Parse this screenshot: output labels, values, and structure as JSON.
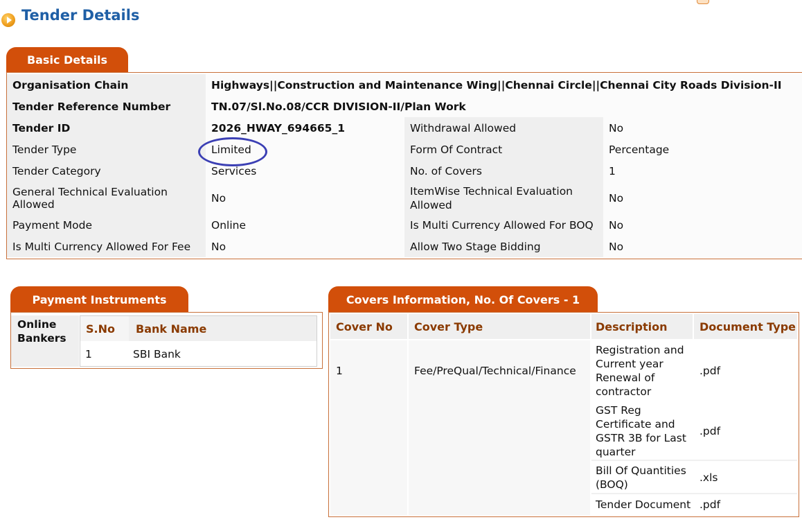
{
  "page": {
    "title": "Tender Details"
  },
  "basic_details": {
    "tab_label": "Basic Details",
    "org_chain_label": "Organisation Chain",
    "org_chain_value": "Highways||Construction and Maintenance Wing||Chennai Circle||Chennai City Roads Division-II",
    "ref_label": "Tender Reference Number",
    "ref_value": "TN.07/Sl.No.08/CCR DIVISION-II/Plan Work",
    "id_label": "Tender ID",
    "id_value": "2026_HWAY_694665_1",
    "withdrawal_label": "Withdrawal Allowed",
    "withdrawal_value": "No",
    "type_label": "Tender Type",
    "type_value": "Limited",
    "contract_label": "Form Of Contract",
    "contract_value": "Percentage",
    "category_label": "Tender Category",
    "category_value": "Services",
    "covers_label": "No. of Covers",
    "covers_value": "1",
    "gte_label": "General Technical Evaluation Allowed",
    "gte_value": "No",
    "itemwise_label": "ItemWise Technical Evaluation Allowed",
    "itemwise_value": "No",
    "payment_label": "Payment Mode",
    "payment_value": "Online",
    "boq_currency_label": "Is Multi Currency Allowed For BOQ",
    "boq_currency_value": "No",
    "fee_currency_label": "Is Multi Currency Allowed For Fee",
    "fee_currency_value": "No",
    "two_stage_label": "Allow Two Stage Bidding",
    "two_stage_value": "No"
  },
  "payment_instruments": {
    "tab_label": "Payment Instruments",
    "group_label": "Online Bankers",
    "col_sno": "S.No",
    "col_bank": "Bank Name",
    "rows": [
      {
        "sno": "1",
        "bank": "SBI Bank"
      }
    ]
  },
  "covers": {
    "tab_label": "Covers Information, No. Of Covers - 1",
    "col_no": "Cover No",
    "col_type": "Cover Type",
    "col_desc": "Description",
    "col_doc": "Document Type",
    "cover_no": "1",
    "cover_type": "Fee/PreQual/Technical/Finance",
    "rows": [
      {
        "desc": "Registration and Current year Renewal of contractor",
        "doc": ".pdf"
      },
      {
        "desc": "GST Reg Certificate and GSTR 3B for Last quarter",
        "doc": ".pdf"
      },
      {
        "desc": "Bill Of Quantities (BOQ)",
        "doc": ".xls"
      },
      {
        "desc": "Tender Document",
        "doc": ".pdf"
      }
    ]
  }
}
